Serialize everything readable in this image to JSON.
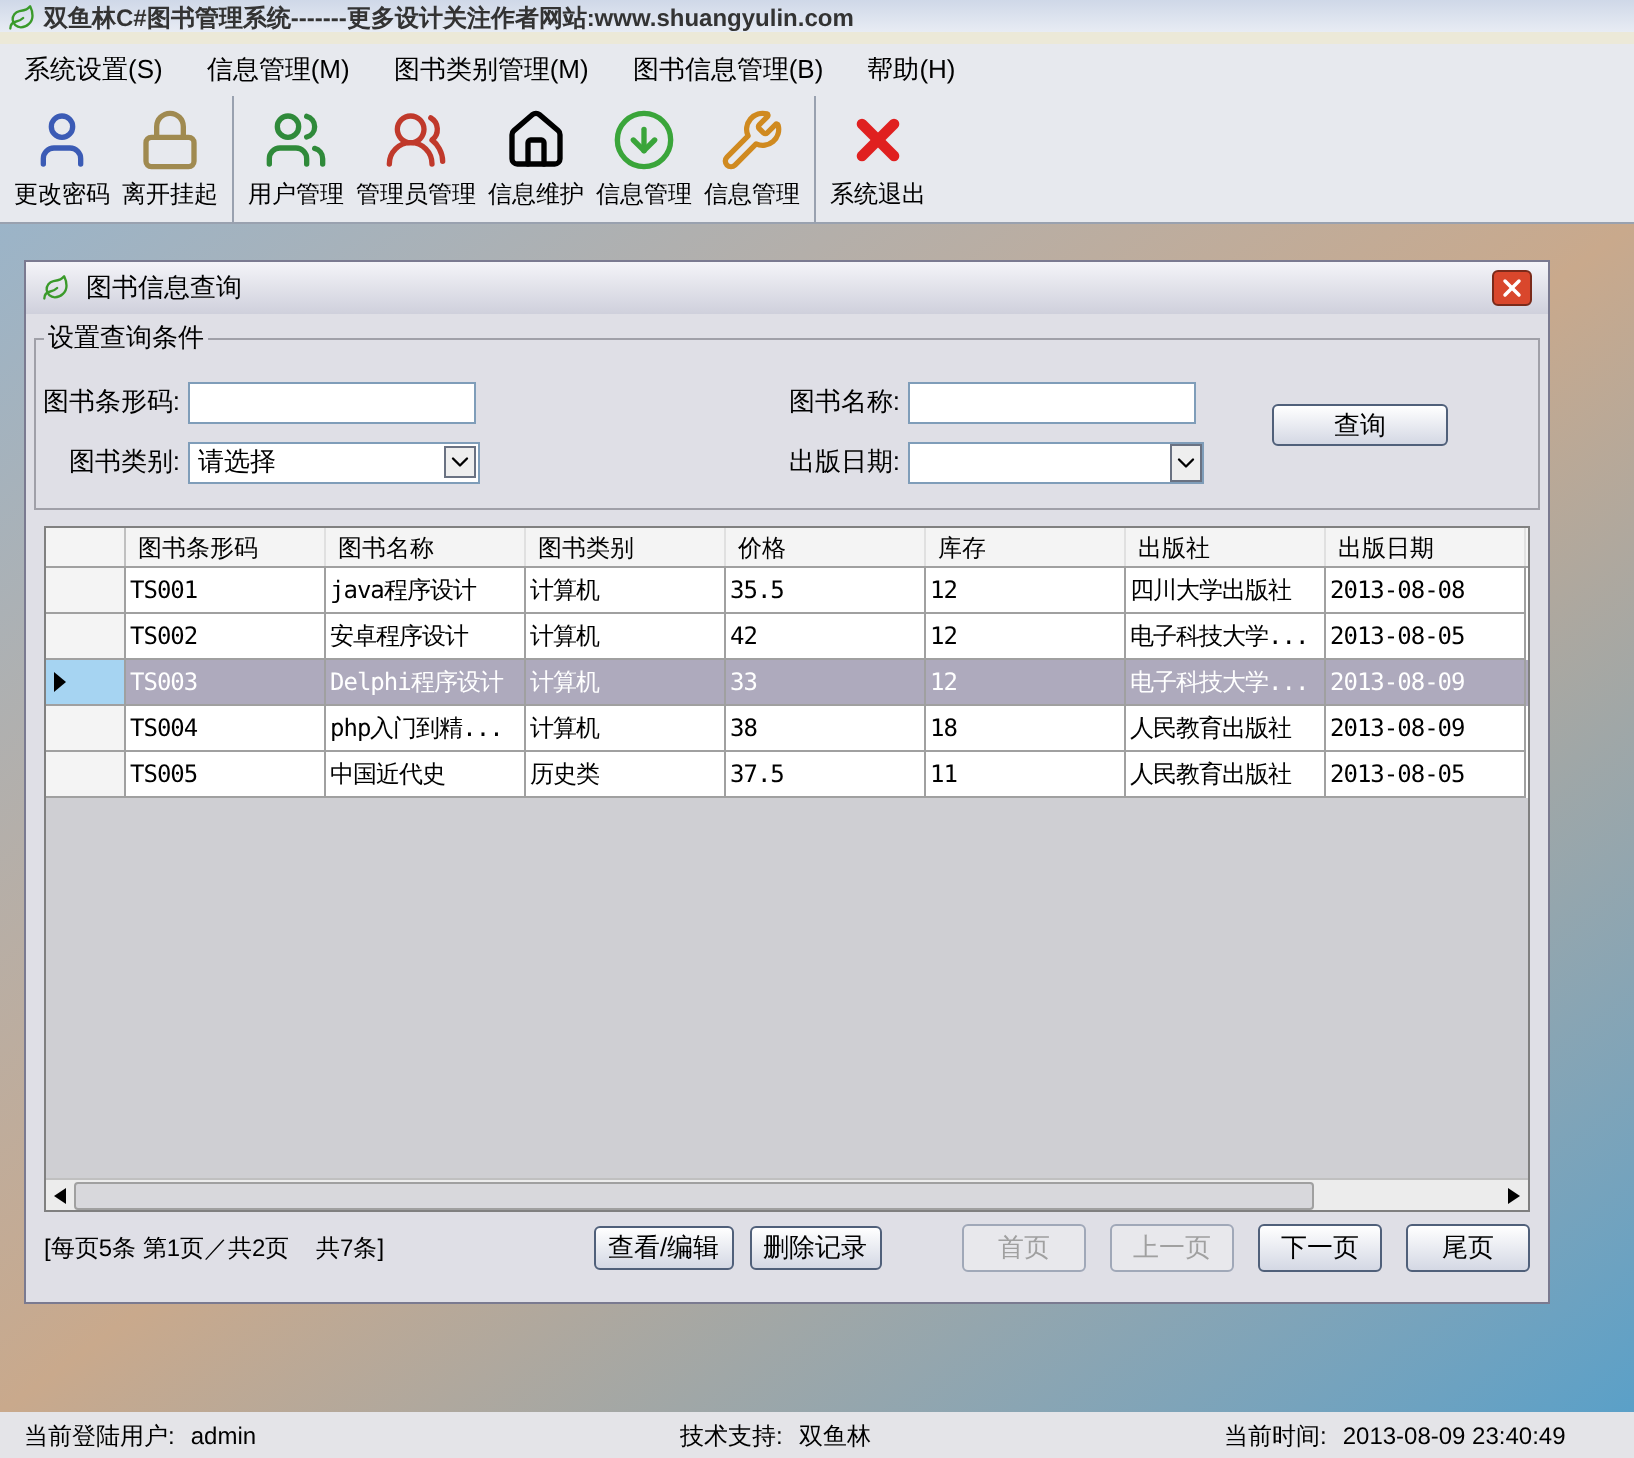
{
  "window": {
    "title": "双鱼林C#图书管理系统-------更多设计关注作者网站:www.shuangyulin.com"
  },
  "menu": [
    "系统设置(S)",
    "信息管理(M)",
    "图书类别管理(M)",
    "图书信息管理(B)",
    "帮助(H)"
  ],
  "toolbar": [
    [
      "更改密码",
      "离开挂起"
    ],
    [
      "用户管理",
      "管理员管理",
      "信息维护",
      "信息管理",
      "信息管理"
    ],
    [
      "系统退出"
    ]
  ],
  "dialog": {
    "title": "图书信息查询",
    "query": {
      "legend": "设置查询条件",
      "fields": [
        {
          "kind": "text",
          "label": "图书条形码:"
        },
        {
          "kind": "text",
          "label": "图书名称:"
        },
        {
          "kind": "select",
          "label": "图书类别:",
          "value": "请选择"
        },
        {
          "kind": "date",
          "label": "出版日期:"
        }
      ],
      "button": "查询"
    },
    "table": {
      "columns": [
        "图书条形码",
        "图书名称",
        "图书类别",
        "价格",
        "库存",
        "出版社",
        "出版日期"
      ],
      "rows": [
        {
          "selected": false,
          "cells": [
            "TS001",
            "java程序设计",
            "计算机",
            "35.5",
            "12",
            "四川大学出版社",
            "2013-08-08"
          ]
        },
        {
          "selected": false,
          "cells": [
            "TS002",
            "安卓程序设计",
            "计算机",
            "42",
            "12",
            "电子科技大学...",
            "2013-08-05"
          ]
        },
        {
          "selected": true,
          "cells": [
            "TS003",
            "Delphi程序设计",
            "计算机",
            "33",
            "12",
            "电子科技大学...",
            "2013-08-09"
          ]
        },
        {
          "selected": false,
          "cells": [
            "TS004",
            "php入门到精...",
            "计算机",
            "38",
            "18",
            "人民教育出版社",
            "2013-08-09"
          ]
        },
        {
          "selected": false,
          "cells": [
            "TS005",
            "中国近代史",
            "历史类",
            "37.5",
            "11",
            "人民教育出版社",
            "2013-08-05"
          ]
        }
      ]
    },
    "paging_info": "[每页5条 第1页／共2页    共7条]",
    "actions": [
      "查看/编辑",
      "删除记录"
    ],
    "pager": [
      {
        "label": "首页",
        "disabled": true
      },
      {
        "label": "上一页",
        "disabled": true
      },
      {
        "label": "下一页",
        "disabled": false
      },
      {
        "label": "尾页",
        "disabled": false
      }
    ]
  },
  "status_bar": [
    {
      "label": "当前登陆用户:",
      "value": "admin"
    },
    {
      "label": "技术支持:",
      "value": "双鱼林"
    },
    {
      "label": "当前时间:",
      "value": "2013-08-09 23:40:49"
    }
  ]
}
